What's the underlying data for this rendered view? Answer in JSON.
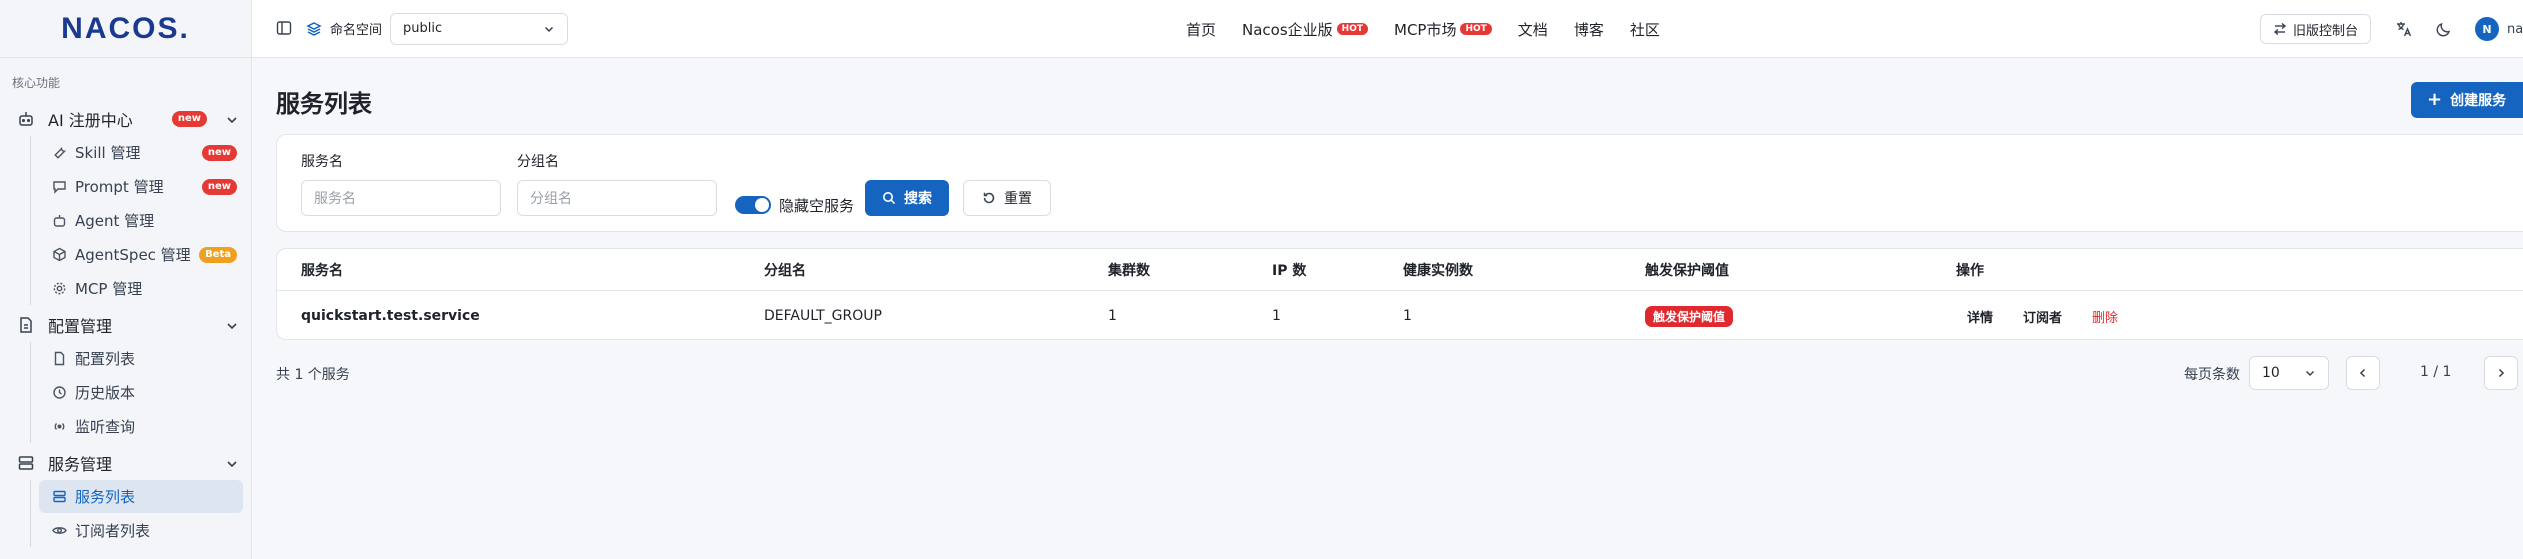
{
  "brand": {
    "logo": "NACOS."
  },
  "sidebar": {
    "section_label": "核心功能",
    "groups": [
      {
        "label": "AI 注册中心",
        "badge": "new",
        "items": [
          {
            "label": "Skill 管理",
            "badge": "new"
          },
          {
            "label": "Prompt 管理",
            "badge": "new"
          },
          {
            "label": "Agent 管理"
          },
          {
            "label": "AgentSpec 管理",
            "badge": "Beta"
          },
          {
            "label": "MCP 管理"
          }
        ]
      },
      {
        "label": "配置管理",
        "items": [
          {
            "label": "配置列表"
          },
          {
            "label": "历史版本"
          },
          {
            "label": "监听查询"
          }
        ]
      },
      {
        "label": "服务管理",
        "items": [
          {
            "label": "服务列表",
            "active": true
          },
          {
            "label": "订阅者列表"
          }
        ]
      }
    ]
  },
  "topbar": {
    "namespace_label": "命名空间",
    "namespace_value": "public",
    "nav": [
      {
        "label": "首页"
      },
      {
        "label": "Nacos企业版",
        "hot": "HOT"
      },
      {
        "label": "MCP市场",
        "hot": "HOT"
      },
      {
        "label": "文档"
      },
      {
        "label": "博客"
      },
      {
        "label": "社区"
      }
    ],
    "old_console": "旧版控制台",
    "avatar_letter": "N",
    "username": "nacos"
  },
  "page": {
    "title": "服务列表",
    "create_button": "创建服务"
  },
  "filters": {
    "service_name_label": "服务名",
    "service_name_placeholder": "服务名",
    "group_name_label": "分组名",
    "group_name_placeholder": "分组名",
    "hide_empty_label": "隐藏空服务",
    "hide_empty_on": true,
    "search_button": "搜索",
    "reset_button": "重置"
  },
  "table": {
    "headers": [
      "服务名",
      "分组名",
      "集群数",
      "IP 数",
      "健康实例数",
      "触发保护阈值",
      "操作"
    ],
    "rows": [
      {
        "service": "quickstart.test.service",
        "group": "DEFAULT_GROUP",
        "clusters": "1",
        "ips": "1",
        "healthy": "1",
        "protection": "触发保护阈值",
        "ops": [
          "详情",
          "订阅者",
          "删除"
        ]
      }
    ]
  },
  "footer": {
    "total": "共 1 个服务",
    "per_page_label": "每页条数",
    "per_page_value": "10",
    "page_info": "1 / 1"
  },
  "colors": {
    "primary": "#1565c0",
    "danger": "#e0292f",
    "beta": "#f0a020"
  }
}
